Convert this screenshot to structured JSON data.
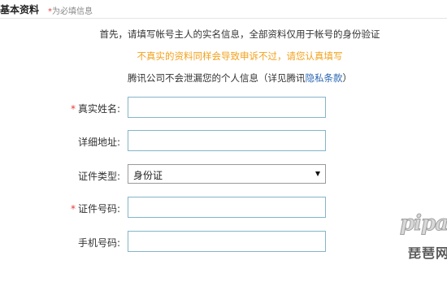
{
  "header": {
    "title": "基本资料",
    "hint_star": "*",
    "hint_text": "为必填信息"
  },
  "intro": {
    "line1": "首先，请填写帐号主人的实名信息，全部资料仅用于帐号的身份验证",
    "line2": "不真实的资料同样会导致申诉不过，请您认真填写",
    "line3_prefix": "腾讯公司不会泄漏您的个人信息（详见腾讯",
    "line3_link": "隐私条款",
    "line3_suffix": "）"
  },
  "form": {
    "required_mark": "*",
    "real_name": {
      "label": "真实姓名:",
      "required": true,
      "value": ""
    },
    "address": {
      "label": "详细地址:",
      "required": false,
      "value": ""
    },
    "id_type": {
      "label": "证件类型:",
      "required": false,
      "selected": "身份证"
    },
    "id_number": {
      "label": "证件号码:",
      "required": true,
      "value": ""
    },
    "phone": {
      "label": "手机号码:",
      "required": false,
      "value": ""
    }
  },
  "watermark": {
    "logo": "pipaw",
    "cn": "琵琶网"
  },
  "colors": {
    "required": "#e43b3b",
    "warning": "#f2a11c",
    "link": "#2a66b3",
    "input_border": "#84b5c9"
  }
}
